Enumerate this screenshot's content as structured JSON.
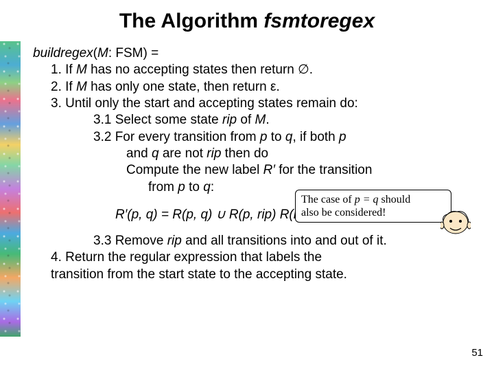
{
  "title": {
    "prefix": "The Algorithm ",
    "name": "fsmtoregex"
  },
  "sig": {
    "fn": "buildregex",
    "arg": "M",
    "type": "FSM",
    "eq": " = "
  },
  "steps": {
    "s1_a": "1. If ",
    "s1_m": "M",
    "s1_b": " has no accepting states then return ",
    "s1_sym": "∅",
    "s1_c": ".",
    "s2_a": "2. If ",
    "s2_m": "M",
    "s2_b": " has only one state, then return ",
    "s2_sym": "ε",
    "s2_c": ".",
    "s3": "3. Until only the start and accepting states remain do:",
    "s31_a": "3.1 Select some state ",
    "s31_rip": "rip",
    "s31_b": " of ",
    "s31_m": "M",
    "s31_c": ".",
    "s32_a": "3.2 For every transition from ",
    "s32_p": "p",
    "s32_b": " to ",
    "s32_q": "q",
    "s32_c": ", if both ",
    "s32_p2": "p",
    "s32l2_a": "and ",
    "s32l2_q": "q",
    "s32l2_b": " are not ",
    "s32l2_rip": "rip",
    "s32l2_c": " then do",
    "comp_a": "Compute the new label ",
    "comp_r": "R′",
    "comp_b": " for the transition",
    "compl2_a": "from ",
    "compl2_p": "p",
    "compl2_b": " to ",
    "compl2_q": "q",
    "compl2_c": ":",
    "s33_a": "3.3 Remove ",
    "s33_rip": "rip",
    "s33_b": " and all transitions into and out of it.",
    "s4_a": "4. Return the regular expression that labels the",
    "s4_b": "transition from the start state to the accepting state."
  },
  "formula": {
    "text": "R′(p, q) = R(p, q) ∪ R(p, rip) R(rip, rip)* R(rip, q)"
  },
  "note": {
    "l1_a": "The case of ",
    "l1_eq": "p = q",
    "l1_b": " should",
    "l2": "also be considered!"
  },
  "page": "51"
}
